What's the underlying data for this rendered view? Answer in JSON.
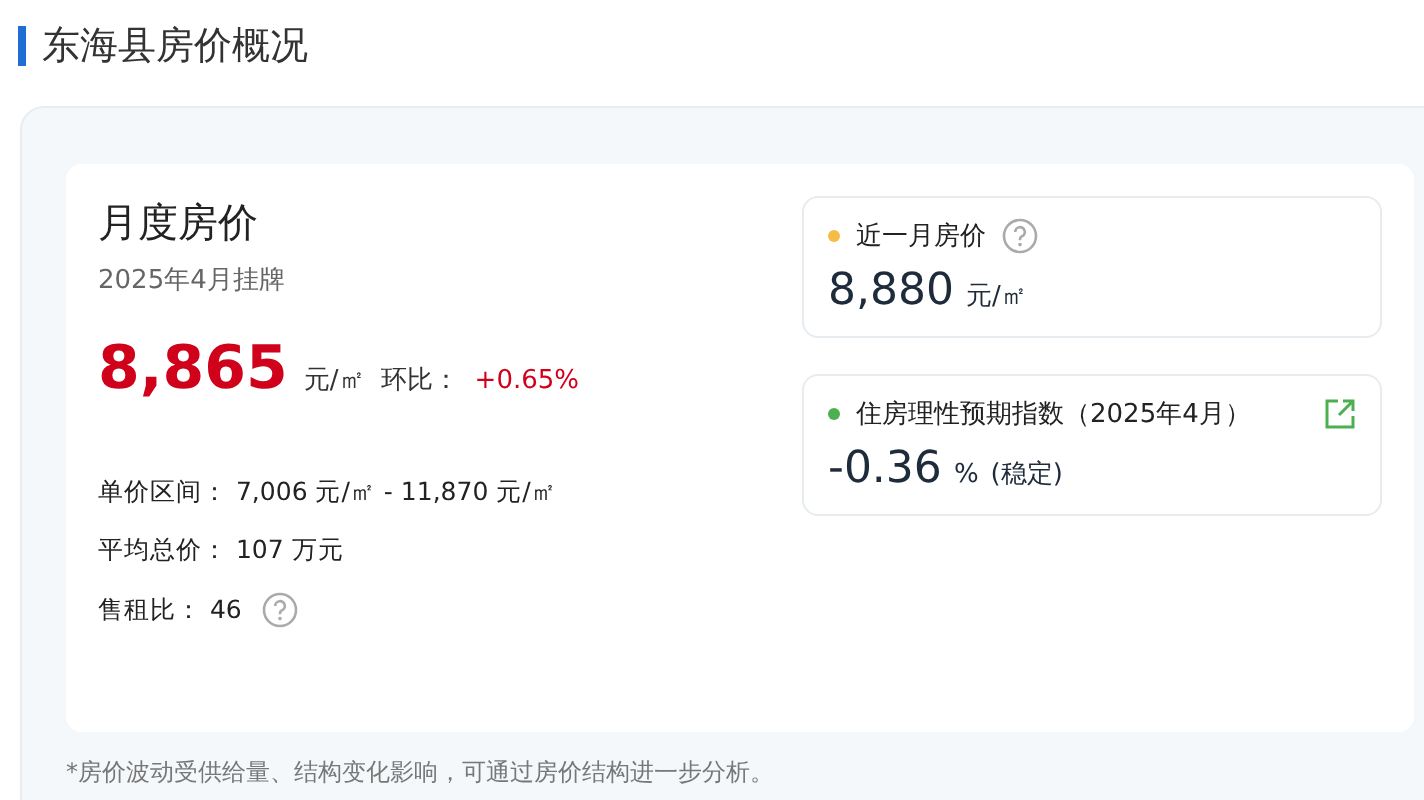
{
  "title": "东海县房价概况",
  "monthly": {
    "title": "月度房价",
    "subtitle": "2025年4月挂牌",
    "price": "8,865",
    "unit": "元/㎡",
    "change_label": "环比：",
    "change": "+0.65%"
  },
  "details": [
    {
      "label": "单价区间：",
      "value": "7,006 元/㎡ - 11,870 元/㎡",
      "help": false
    },
    {
      "label": "平均总价：",
      "value": "107 万元",
      "help": false
    },
    {
      "label": "售租比：",
      "value": "46",
      "help": true
    }
  ],
  "stats": [
    {
      "title": "近一月房价",
      "color": "#f5bd45",
      "value": "8,880",
      "unit": "元/㎡",
      "kind": "help"
    },
    {
      "title": "住房理性预期指数（2025年4月）",
      "color": "#4caf50",
      "value": "-0.36",
      "unit": "%",
      "note": "(稳定)",
      "kind": "link"
    }
  ],
  "footnote": "*房价波动受供给量、结构变化影响，可通过房价结构进一步分析。"
}
